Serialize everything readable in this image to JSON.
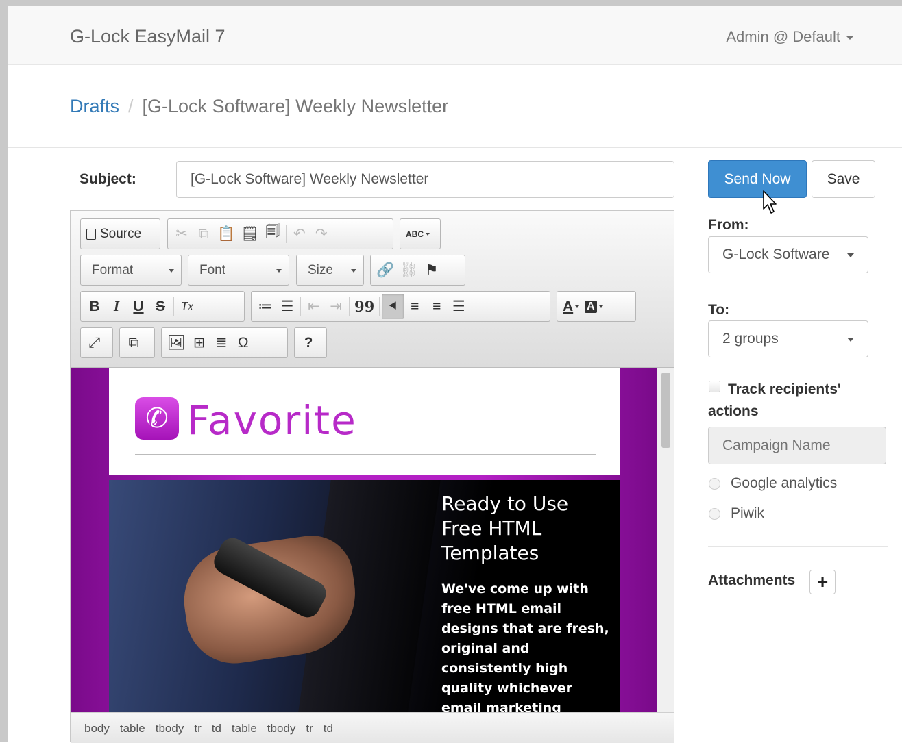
{
  "app": {
    "brand": "G-Lock EasyMail 7",
    "user_menu": "Admin @ Default"
  },
  "breadcrumb": {
    "parent": "Drafts",
    "separator": "/",
    "current": "[G-Lock Software] Weekly Newsletter"
  },
  "subject": {
    "label": "Subject:",
    "value": "[G-Lock Software] Weekly Newsletter"
  },
  "toolbar": {
    "source_label": "Source",
    "format_label": "Format",
    "font_label": "Font",
    "size_label": "Size",
    "spellcheck_label": "ABC",
    "bold": "B",
    "italic": "I",
    "underline": "U",
    "strike": "S",
    "remove_format": "Tx",
    "blockquote": "99",
    "help": "?",
    "special_char": "Ω",
    "text_color": "A",
    "bg_color": "A"
  },
  "email": {
    "logo_text": "Favorite",
    "hero_title": "Ready to Use Free HTML Templates",
    "hero_body": "We've come up with free HTML email designs that are fresh, original and consistently high quality whichever email marketing"
  },
  "pathbar": [
    "body",
    "table",
    "tbody",
    "tr",
    "td",
    "table",
    "tbody",
    "tr",
    "td"
  ],
  "actions": {
    "send_now": "Send Now",
    "save": "Save"
  },
  "from": {
    "label": "From:",
    "selected": "G-Lock Software"
  },
  "to": {
    "label": "To:",
    "selected": "2 groups"
  },
  "tracking": {
    "label": "Track recipients' actions",
    "checked": false,
    "campaign_placeholder": "Campaign Name",
    "options": [
      "Google analytics",
      "Piwik"
    ]
  },
  "attachments": {
    "label": "Attachments",
    "add_symbol": "+"
  },
  "colors": {
    "primary": "#3f8fd2",
    "link": "#337ab7",
    "email_accent": "#b320c4"
  }
}
